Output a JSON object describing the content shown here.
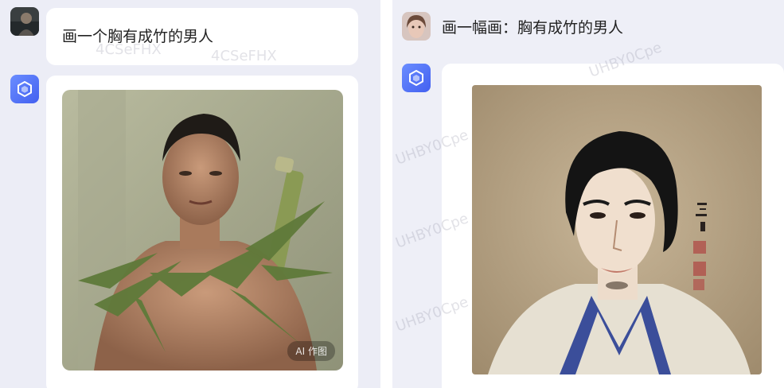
{
  "left": {
    "user_prompt": "画一个胸有成竹的男人",
    "badge": "AI 作图",
    "watermark": "4CSeFHX"
  },
  "right": {
    "user_prompt": "画一幅画：胸有成竹的男人",
    "watermark": "UHBY0Cpe"
  },
  "icons": {
    "bot": "cube-logo-icon",
    "user_avatar_left": "user-avatar-photo",
    "user_avatar_right": "user-avatar-photo"
  },
  "colors": {
    "left_panel_bg": "#ecedf6",
    "right_panel_bg": "#eeeff7",
    "bot_icon": "#4f6bf6",
    "bubble": "#ffffff"
  }
}
